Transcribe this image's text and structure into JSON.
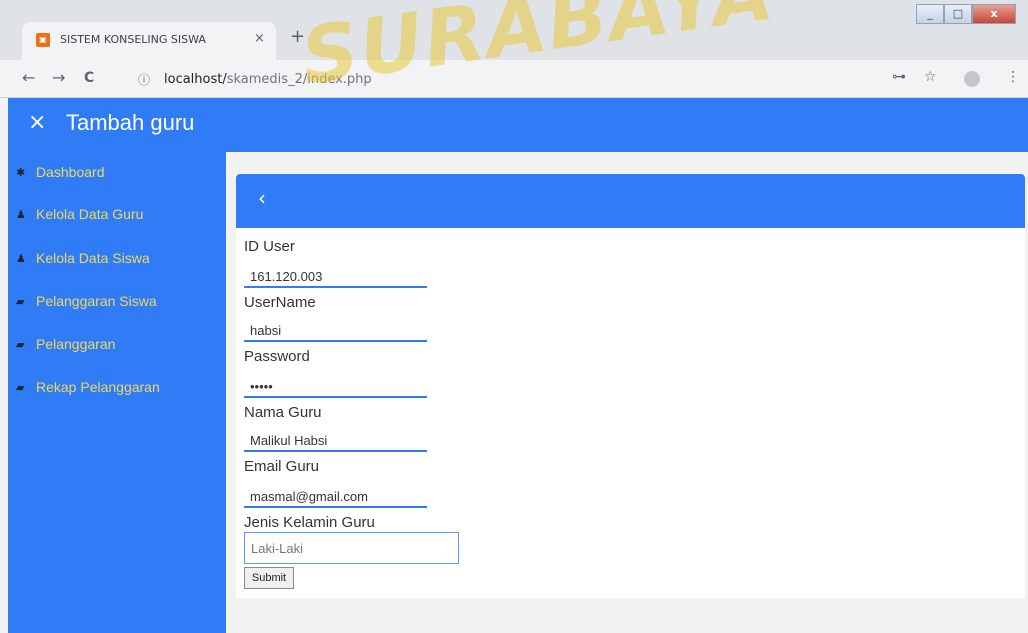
{
  "browser": {
    "tab_title": "SISTEM KONSELING SISWA",
    "tab_close": "×",
    "new_tab": "+",
    "url_host": "localhost/",
    "url_path": "skamedis_2/index.php",
    "back": "←",
    "forward": "→",
    "reload": "C",
    "info": "ⓘ",
    "key": "⊶",
    "star": "☆",
    "menu": "⋮"
  },
  "header": {
    "close_icon": "×",
    "title": "Tambah guru"
  },
  "sidebar": {
    "items": [
      {
        "icon": "home-icon",
        "glyph": "✱",
        "label": "Dashboard"
      },
      {
        "icon": "user-icon",
        "glyph": "♟",
        "label": "Kelola Data Guru"
      },
      {
        "icon": "user-icon",
        "glyph": "♟",
        "label": "Kelola Data Siswa"
      },
      {
        "icon": "book-icon",
        "glyph": "▰",
        "label": "Pelanggaran Siswa"
      },
      {
        "icon": "book-icon",
        "glyph": "▰",
        "label": "Pelanggaran"
      },
      {
        "icon": "book-icon",
        "glyph": "▰",
        "label": "Rekap Pelanggaran"
      }
    ]
  },
  "form": {
    "back_icon": "‹",
    "fields": [
      {
        "label": "ID User",
        "value": "161.120.003"
      },
      {
        "label": "UserName",
        "value": "habsi"
      },
      {
        "label": "Password",
        "value": "•••••"
      },
      {
        "label": "Nama Guru",
        "value": "Malikul Habsi"
      },
      {
        "label": "Email Guru",
        "value": "masmal@gmail.com"
      },
      {
        "label": "Jenis Kelamin Guru",
        "value": "Laki-Laki"
      }
    ],
    "submit_label": "Submit"
  },
  "watermark": "SURABAYA",
  "colors": {
    "accent": "#2f7cf6",
    "sidebar_text": "#f0d85a"
  }
}
